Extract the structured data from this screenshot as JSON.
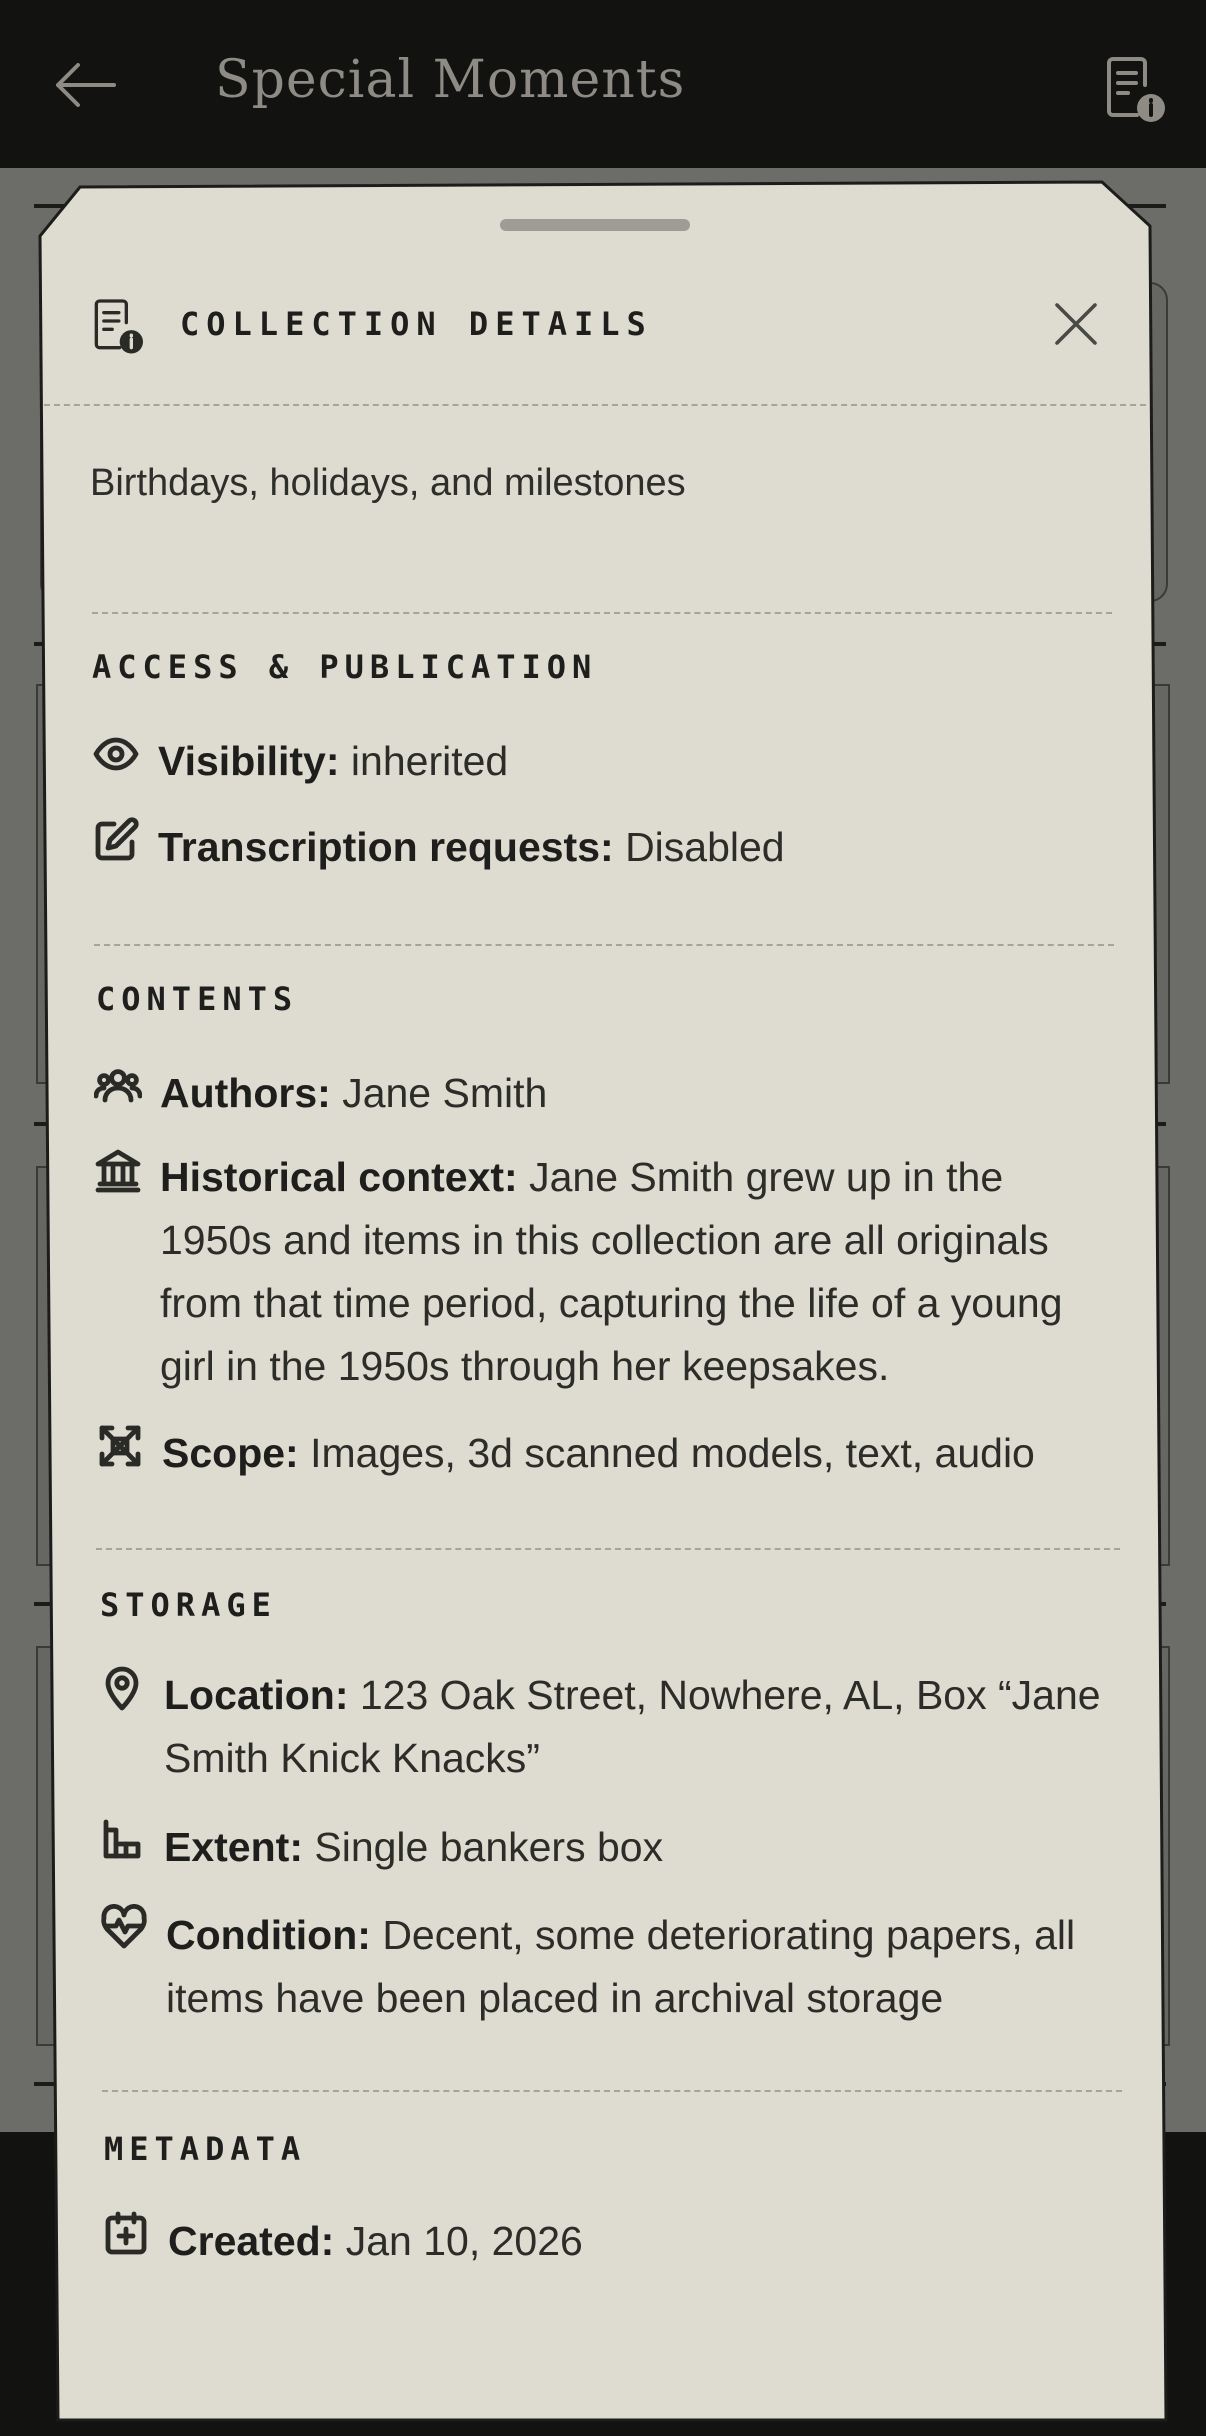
{
  "appbar": {
    "title": "Special Moments"
  },
  "sheet": {
    "title": "COLLECTION DETAILS",
    "description": "Birthdays, holidays, and milestones",
    "sections": {
      "access": {
        "title": "ACCESS & PUBLICATION",
        "visibility": {
          "label": "Visibility",
          "value": "inherited",
          "icon": "eye-icon"
        },
        "transcription": {
          "label": "Transcription requests",
          "value": "Disabled",
          "icon": "edit-icon"
        }
      },
      "contents": {
        "title": "CONTENTS",
        "authors": {
          "label": "Authors",
          "value": "Jane Smith",
          "icon": "users-icon"
        },
        "context": {
          "label": "Historical context",
          "value": "Jane Smith grew up in the 1950s and items in this collection are all originals from that time period, capturing the life of a young girl in the 1950s through her keepsakes.",
          "icon": "building-columns-icon"
        },
        "scope": {
          "label": "Scope",
          "value": "Images, 3d scanned models, text, audio",
          "icon": "scope-icon"
        }
      },
      "storage": {
        "title": "STORAGE",
        "location": {
          "label": "Location",
          "value": "123 Oak Street, Nowhere, AL, Box “Jane Smith Knick Knacks”",
          "icon": "map-pin-icon"
        },
        "extent": {
          "label": "Extent",
          "value": "Single bankers box",
          "icon": "box-icon"
        },
        "condition": {
          "label": "Condition",
          "value": "Decent, some deteriorating papers, all items have been placed in archival storage",
          "icon": "heart-pulse-icon"
        }
      },
      "metadata": {
        "title": "METADATA",
        "created": {
          "label": "Created",
          "value": "Jan 10, 2026",
          "icon": "calendar-plus-icon"
        }
      }
    }
  },
  "colors": {
    "sheet_bg": "#dedbd0",
    "text": "#2c2c29",
    "appbar_bg": "#121211",
    "scrim": "#6c6c69"
  }
}
